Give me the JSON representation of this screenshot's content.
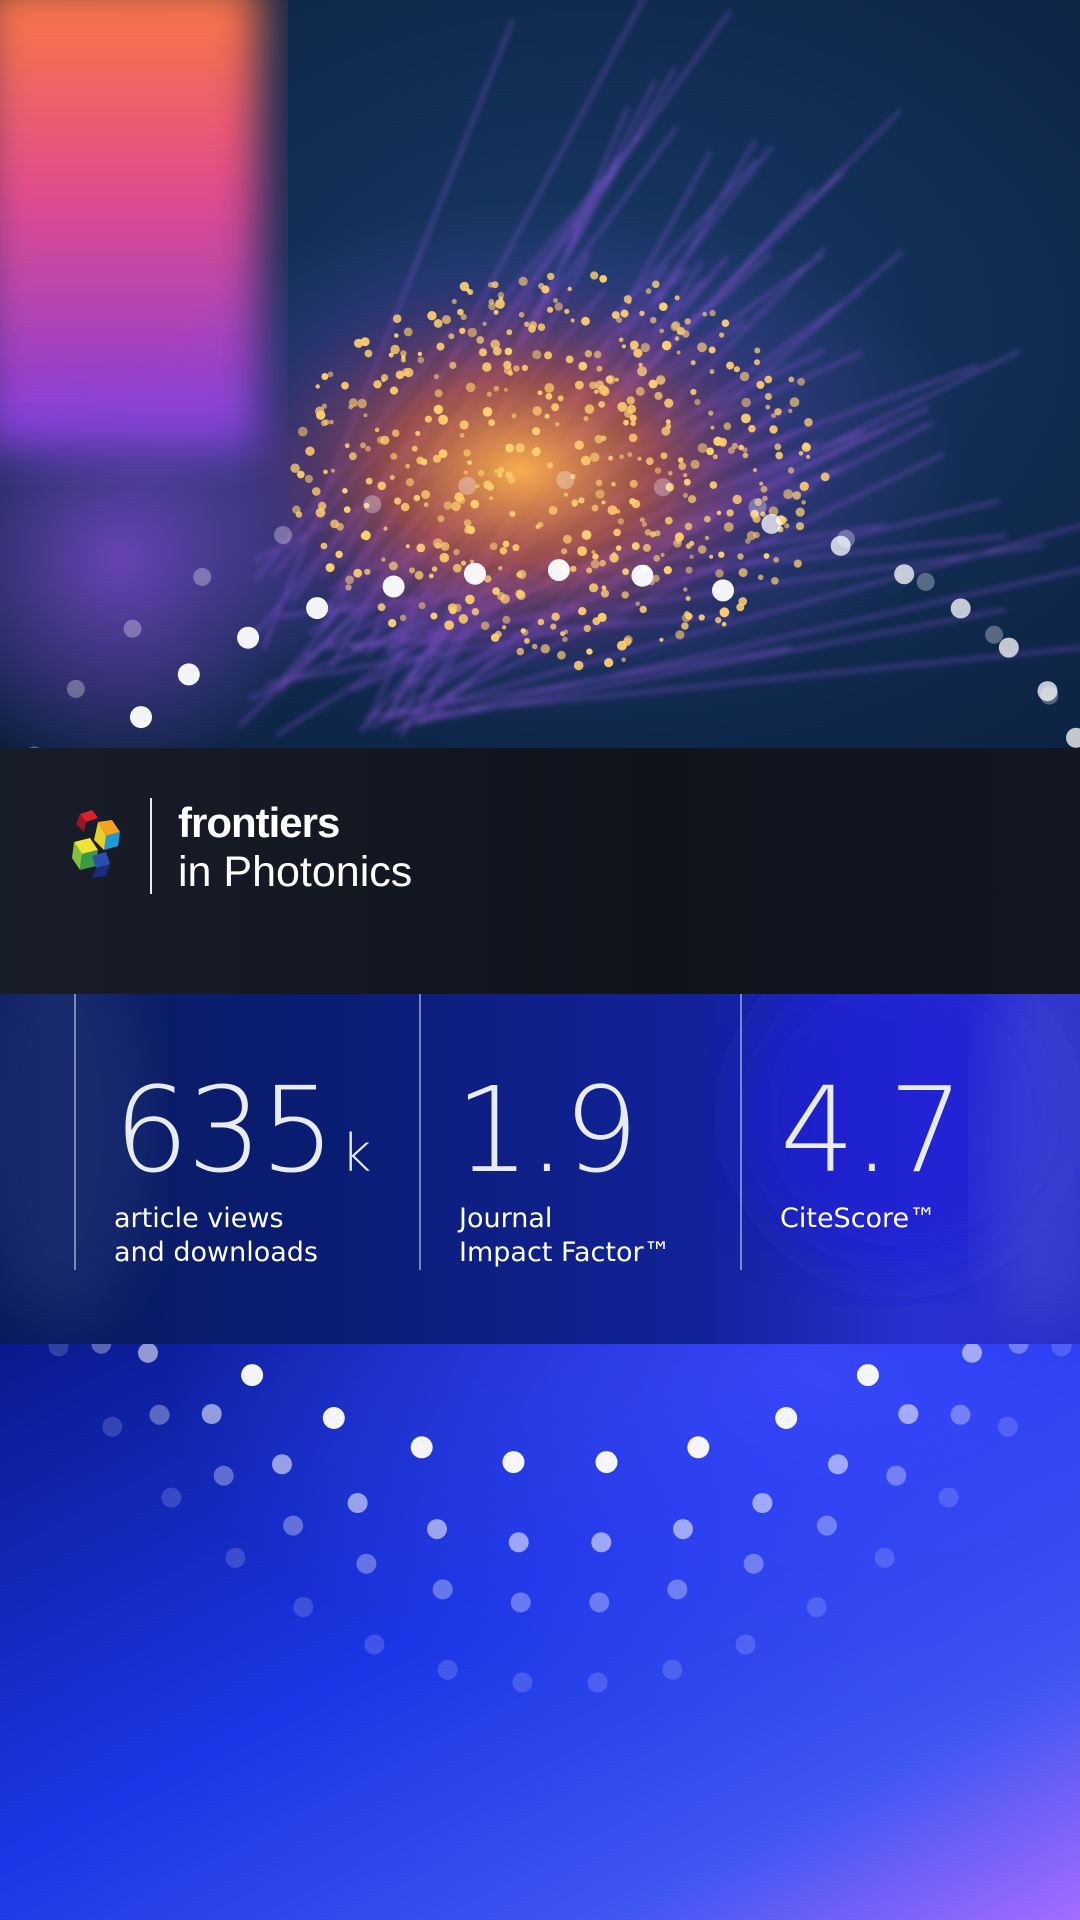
{
  "brand": {
    "name": "frontiers",
    "journal": "in Photonics"
  },
  "stats": [
    {
      "value": "635",
      "unit": "k",
      "label_lines": [
        "article views",
        "and downloads"
      ]
    },
    {
      "value": "1.9",
      "unit": "",
      "label_lines": [
        "Journal",
        "Impact Factor™"
      ]
    },
    {
      "value": "4.7",
      "unit": "",
      "label_lines": [
        "CiteScore™"
      ]
    }
  ],
  "colors": {
    "hero_background": "#0d2547",
    "brand_band": "#151a26",
    "stats_band": "#0c1c6e",
    "bottom_gradient_start": "#0b1aa6",
    "bottom_gradient_end": "#9a6cff",
    "fiber_glow": "#ffb64a"
  },
  "images": {
    "hero": "optical-fiber-bundle-photo",
    "logo": "frontiers-cube-logo"
  }
}
